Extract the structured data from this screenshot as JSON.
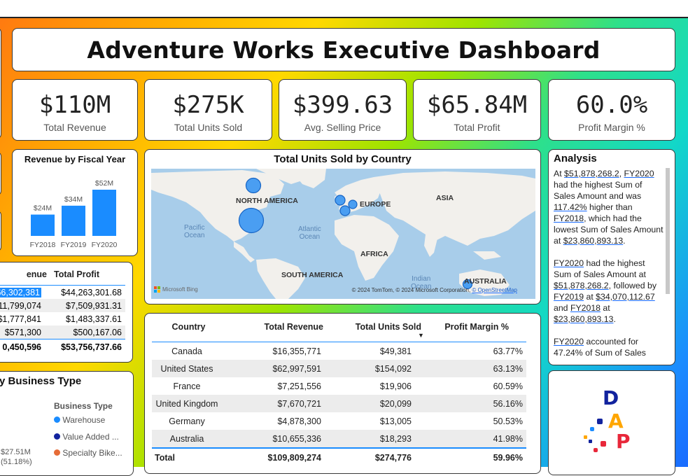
{
  "title": "Adventure Works Executive Dashboard",
  "colors": {
    "accent": "#1a8cff",
    "bar": "#1a8cff",
    "bubble": "#4a9ef2"
  },
  "kpis": [
    {
      "value": "$110M",
      "label": "Total Revenue"
    },
    {
      "value": "$275K",
      "label": "Total Units Sold"
    },
    {
      "value": "$399.63",
      "label": "Avg. Selling Price"
    },
    {
      "value": "$65.84M",
      "label": "Total Profit"
    },
    {
      "value": "60.0%",
      "label": "Profit Margin %"
    }
  ],
  "revenue_chart": {
    "title": "Revenue by Fiscal Year"
  },
  "chart_data": {
    "type": "bar",
    "title": "Revenue by Fiscal Year",
    "categories": [
      "FY2018",
      "FY2019",
      "FY2020"
    ],
    "values": [
      24,
      34,
      52
    ],
    "data_labels": [
      "$24M",
      "$34M",
      "$52M"
    ],
    "xlabel": "",
    "ylabel": "",
    "ylim": [
      0,
      55
    ]
  },
  "left_table": {
    "headers": [
      "enue",
      "Total Profit"
    ],
    "rows": [
      [
        "66,302,381",
        "$44,263,301.68"
      ],
      [
        "11,799,074",
        "$7,509,931.31"
      ],
      [
        "$1,777,841",
        "$1,483,337.61"
      ],
      [
        "$571,300",
        "$500,167.06"
      ]
    ],
    "total": [
      "0,450,596",
      "$53,756,737.66"
    ]
  },
  "business_type": {
    "title": "y Business Type",
    "legend_title": "Business Type",
    "items": [
      {
        "label": "Warehouse",
        "color": "#1a8cff"
      },
      {
        "label": "Value Added ...",
        "color": "#12239e"
      },
      {
        "label": "Specialty Bike...",
        "color": "#e66c37"
      }
    ],
    "slice_label_value": "$27.51M",
    "slice_label_pct": "(51.18%)"
  },
  "map": {
    "title": "Total Units Sold by Country",
    "labels": {
      "north_america": "NORTH AMERICA",
      "europe": "EUROPE",
      "asia": "ASIA",
      "africa": "AFRICA",
      "south_america": "SOUTH AMERICA",
      "australia": "AUSTRALIA",
      "pacific": "Pacific",
      "pacific2": "Ocean",
      "atlantic": "Atlantic",
      "atlantic2": "Ocean",
      "indian": "Indian",
      "indian2": "Ocean"
    },
    "logo_text": "Microsoft Bing",
    "attribution": "© 2024 TomTom, © 2024 Microsoft Corporation,",
    "attribution_link": "© OpenStreetMap"
  },
  "country_table": {
    "headers": [
      "Country",
      "Total Revenue",
      "Total Units Sold",
      "Profit Margin %"
    ],
    "rows": [
      [
        "Canada",
        "$16,355,771",
        "$49,381",
        "63.77%"
      ],
      [
        "United States",
        "$62,997,591",
        "$154,092",
        "63.13%"
      ],
      [
        "France",
        "$7,251,556",
        "$19,906",
        "60.59%"
      ],
      [
        "United Kingdom",
        "$7,670,721",
        "$20,099",
        "56.16%"
      ],
      [
        "Germany",
        "$4,878,300",
        "$13,005",
        "50.53%"
      ],
      [
        "Australia",
        "$10,655,336",
        "$18,293",
        "41.98%"
      ]
    ],
    "total": [
      "Total",
      "$109,809,274",
      "$274,776",
      "59.96%"
    ]
  },
  "analysis": {
    "title": "Analysis",
    "p1_a": "At ",
    "p1_link1": "$51,878,268.2",
    "p1_b": ", ",
    "p1_link2": "FY2020",
    "p1_c": " had the highest Sum of Sales Amount and was ",
    "p1_link3": "117.42%",
    "p1_d": " higher than ",
    "p1_link4": "FY2018",
    "p1_e": ", which had the lowest Sum of Sales Amount at ",
    "p1_link5": "$23,860,893.13",
    "p1_f": ".",
    "p2_link1": "FY2020",
    "p2_a": " had the highest Sum of Sales Amount at ",
    "p2_link2": "$51,878,268.2",
    "p2_b": ", followed by ",
    "p2_link3": "FY2019",
    "p2_c": " at ",
    "p2_link4": "$34,070,112.67",
    "p2_d": " and ",
    "p2_link5": "FY2018",
    "p2_e": " at ",
    "p2_link6": "$23,860,893.13",
    "p2_f": ".",
    "p3_link1": "FY2020",
    "p3_a": " accounted for 47.24% of Sum of Sales"
  },
  "logo": {
    "letters": [
      "D",
      "A",
      "P"
    ]
  }
}
